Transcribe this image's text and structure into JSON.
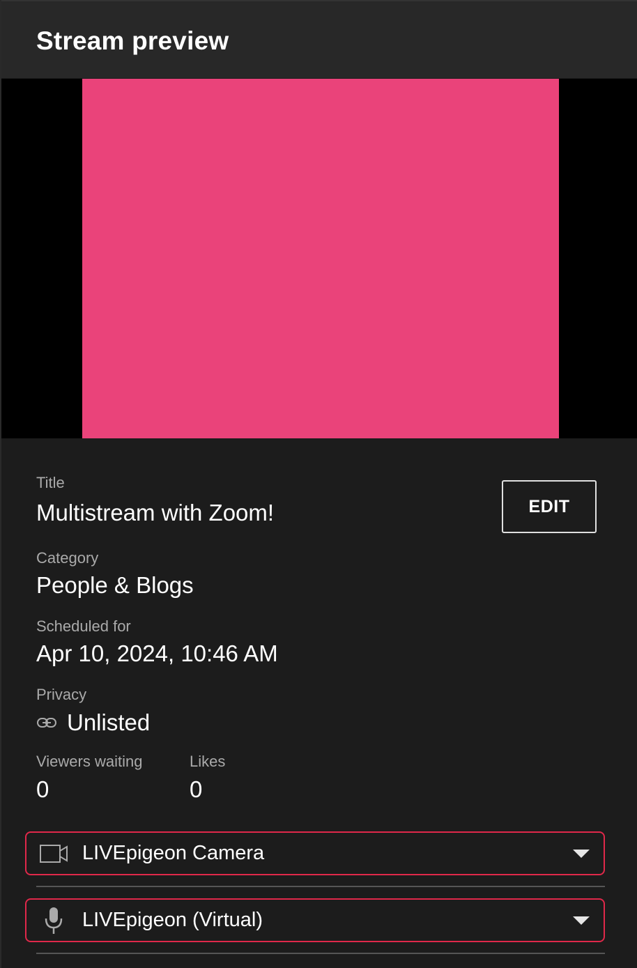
{
  "header": {
    "title": "Stream preview"
  },
  "preview": {
    "fill_color": "#ea437a"
  },
  "details": {
    "title_label": "Title",
    "title_value": "Multistream with Zoom!",
    "edit_label": "EDIT",
    "category_label": "Category",
    "category_value": "People & Blogs",
    "scheduled_label": "Scheduled for",
    "scheduled_value": "Apr 10, 2024, 10:46 AM",
    "privacy_label": "Privacy",
    "privacy_icon": "link-icon",
    "privacy_value": "Unlisted",
    "viewers_label": "Viewers waiting",
    "viewers_value": "0",
    "likes_label": "Likes",
    "likes_value": "0"
  },
  "devices": {
    "camera": {
      "icon": "video-camera-icon",
      "value": "LIVEpigeon Camera"
    },
    "microphone": {
      "icon": "microphone-icon",
      "value": "LIVEpigeon (Virtual)"
    }
  },
  "colors": {
    "accent": "#e0284a",
    "background": "#1c1c1c",
    "header_background": "#282828",
    "preview_fill": "#ea437a"
  }
}
